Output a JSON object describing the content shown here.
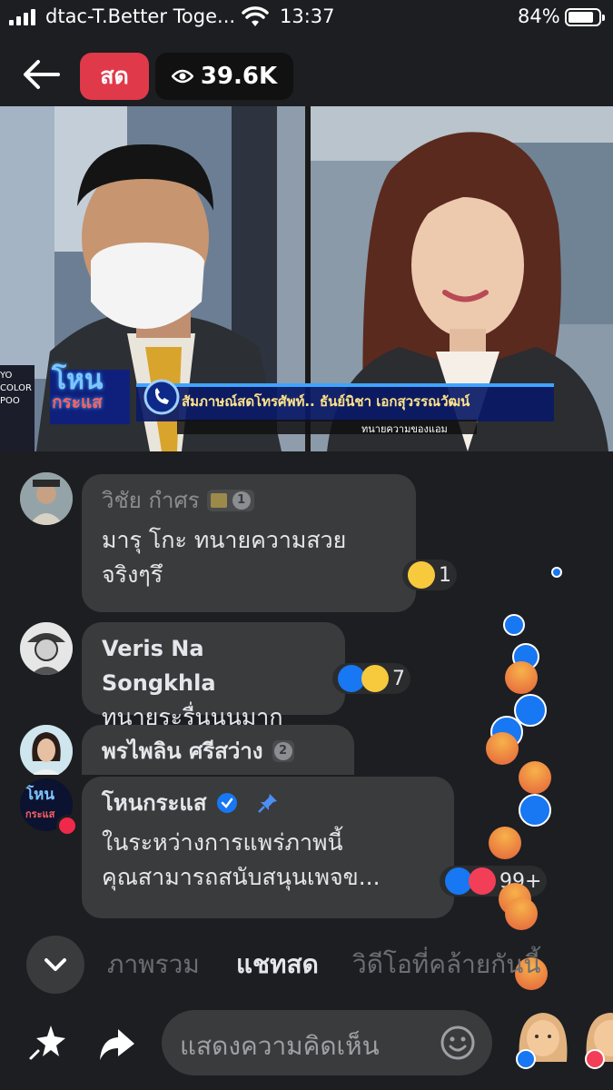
{
  "status_bar": {
    "carrier": "dtac-T.Better Toge...",
    "time": "13:37",
    "battery_percent": "84%",
    "battery_level": 0.84
  },
  "top_bar": {
    "live_label": "สด",
    "viewer_count": "39.6K"
  },
  "video": {
    "program_logo_top": "โหน",
    "program_logo_bottom": "กระแส",
    "caption_main": "สัมภาษณ์สดโทรศัพท์.. ธันย์นิชา  เอกสุวรรณวัฒน์",
    "caption_sub": "ทนายความของแอม",
    "side_text": [
      "YO",
      "COLOR",
      "POO"
    ]
  },
  "comments": [
    {
      "name": "วิชัย กำศร",
      "text_line1": "มารุ โกะ ทนายความสวย",
      "text_line2": "จริงๆรึ",
      "reaction_count": "1",
      "badge": "1"
    },
    {
      "name": "Veris Na Songkhla",
      "text_line1": "ทนายระรื่นนนมาก",
      "reaction_count": "7"
    },
    {
      "name": "พรไพลิน ศรีสว่าง",
      "badge": "2"
    },
    {
      "name": "โหนกระแส",
      "avatar_text_top": "โหน",
      "avatar_text_bottom": "กระแส",
      "text_line1": "ในระหว่างการแพร่ภาพนี้",
      "text_line2": "คุณสามารถสนับสนุนเพจข...",
      "reaction_count": "99+"
    }
  ],
  "tabs": [
    {
      "label": "ภาพรวม",
      "active": false
    },
    {
      "label": "แชทสด",
      "active": true
    },
    {
      "label": "วิดีโอที่คล้ายกันนี้",
      "active": false
    }
  ],
  "bottom_bar": {
    "comment_placeholder": "แสดงความคิดเห็น"
  },
  "colors": {
    "live_red": "#e0394a",
    "like_blue": "#1877f2",
    "love_red": "#f33e58",
    "background": "#1c1e21",
    "bubble": "#3a3b3c"
  },
  "icons": [
    "back-arrow-icon",
    "eye-icon",
    "wifi-icon",
    "chevron-down-icon",
    "star-sparkle-icon",
    "share-arrow-icon",
    "emoji-icon",
    "pin-icon",
    "verified-icon"
  ]
}
